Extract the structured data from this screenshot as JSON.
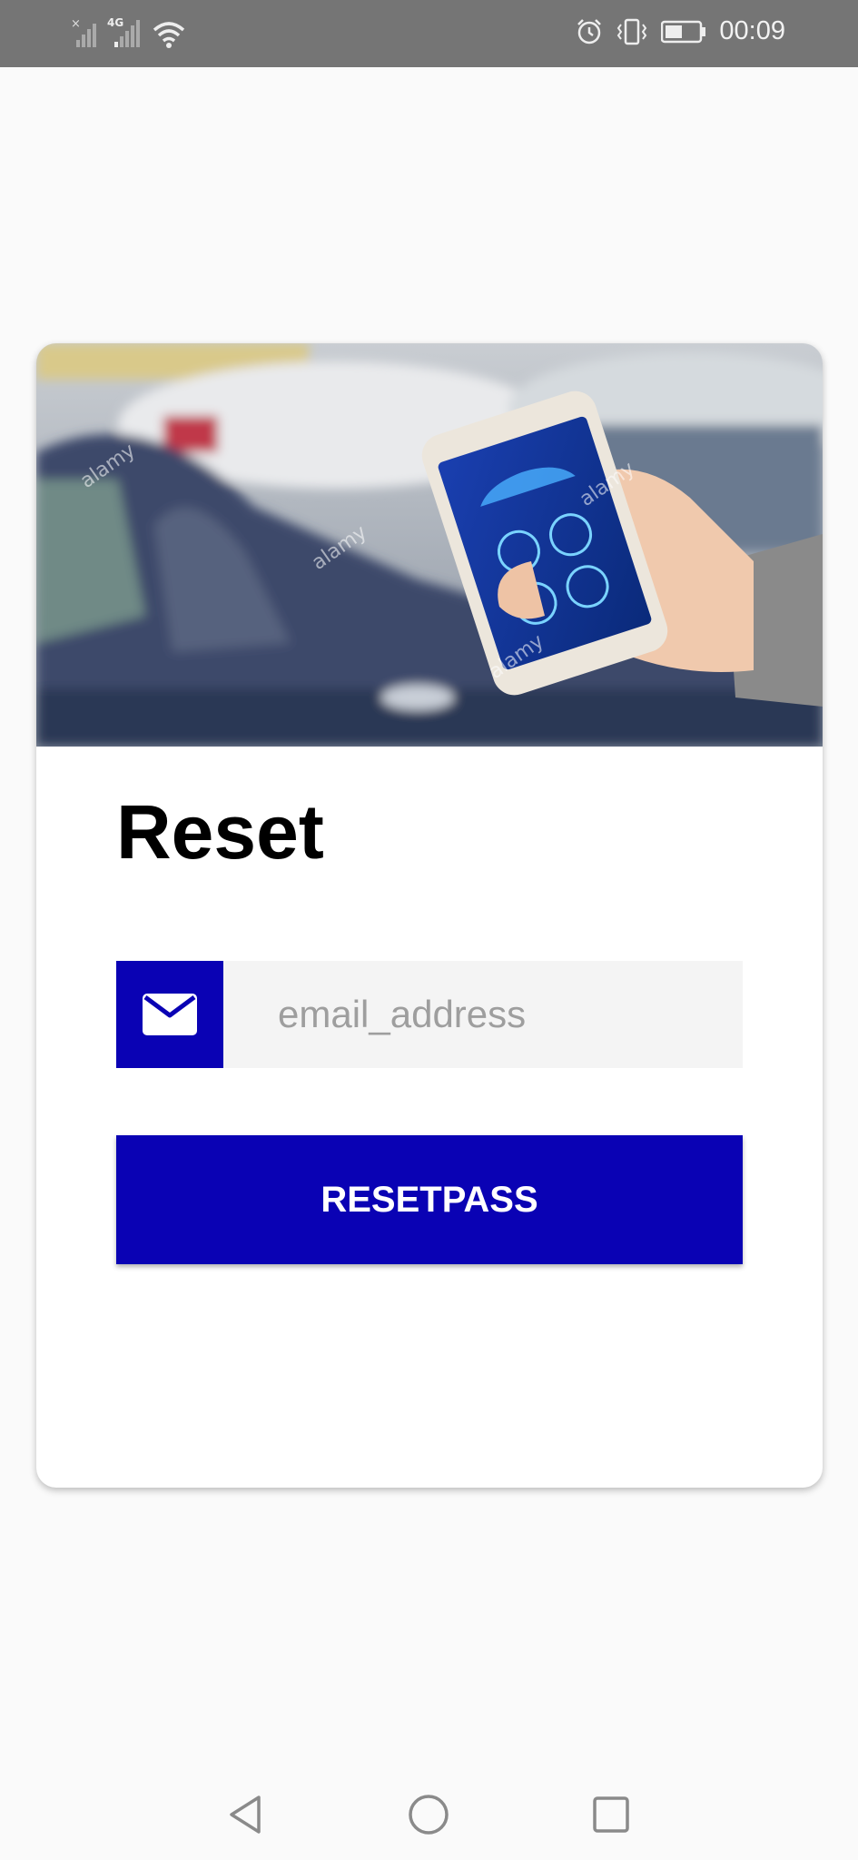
{
  "status_bar": {
    "time": "00:09",
    "network_type": "4G",
    "icons": [
      "no-signal-icon",
      "signal-4g-icon",
      "wifi-icon",
      "alarm-icon",
      "vibrate-icon",
      "battery-icon"
    ]
  },
  "hero": {
    "image": "phone-in-hand-car-app-photo",
    "watermark": "alamy"
  },
  "reset": {
    "title": "Reset",
    "email_placeholder": "email_address",
    "email_icon": "envelope-icon",
    "button_label": "RESETPASS"
  },
  "colors": {
    "accent": "#0a02b4",
    "status_bar": "#757575",
    "background": "#fafafa",
    "input_bg": "#f4f4f4"
  },
  "nav_bar": {
    "icons": [
      "back-icon",
      "home-icon",
      "recents-icon"
    ]
  }
}
